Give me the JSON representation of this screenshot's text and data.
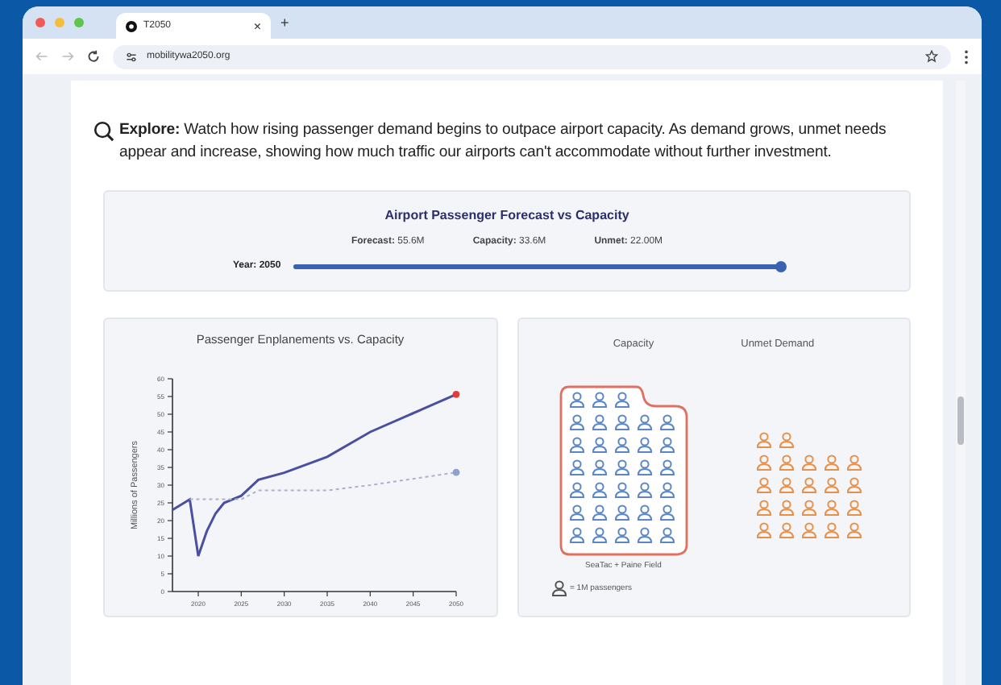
{
  "browser": {
    "tab": {
      "title": "T2050",
      "close": "×"
    },
    "new_tab": "+",
    "address": "mobilitywa2050.org"
  },
  "intro": {
    "text": "**Explore:** Watch how rising passenger demand begins to outpace airport capacity. As demand grows, unmet needs appear and increase, showing how much traffic our airports can't accommodate without further investment."
  },
  "summary": {
    "title": "Airport Passenger Forecast vs Capacity",
    "stats": [
      {
        "label": "Forecast:",
        "value": "55.6M"
      },
      {
        "label": "Capacity:",
        "value": "33.6M"
      },
      {
        "label": "Unmet:",
        "value": "22.00M"
      }
    ],
    "slider": {
      "label": "Year: 2050",
      "level": 1
    }
  },
  "line_chart": {
    "chart_data": {
      "type": "line",
      "title": "Passenger Enplanements vs. Capacity",
      "ylabel": "Millions of Passengers",
      "x": [
        2017,
        2019,
        2020,
        2021,
        2022,
        2023,
        2025,
        2027,
        2030,
        2035,
        2040,
        2050
      ],
      "series": [
        {
          "color": "#4a4fa0",
          "line_style": "solid",
          "values": [
            23,
            26,
            10,
            17,
            22,
            25,
            27,
            31.5,
            33.5,
            38,
            45,
            55.6
          ]
        },
        {
          "color": "#aab2cf",
          "line_style": "dashed",
          "values": [
            null,
            26,
            26,
            26,
            26,
            26,
            26,
            28.5,
            28.5,
            28.5,
            30,
            33.6
          ]
        }
      ],
      "xlim": [
        2017,
        2050
      ],
      "ylim": [
        0,
        60
      ],
      "xticks": [
        2020,
        2025,
        2030,
        2035,
        2040,
        2045,
        2050
      ],
      "yticks": [
        0,
        5,
        10,
        15,
        20,
        25,
        30,
        35,
        40,
        45,
        50,
        55,
        60
      ]
    }
  },
  "pictograph": {
    "capacity_title": "Capacity",
    "unmet_title": "Unmet Demand",
    "capacity_caption": "SeaTac + Paine Field",
    "legend": "= 1M passengers"
  }
}
